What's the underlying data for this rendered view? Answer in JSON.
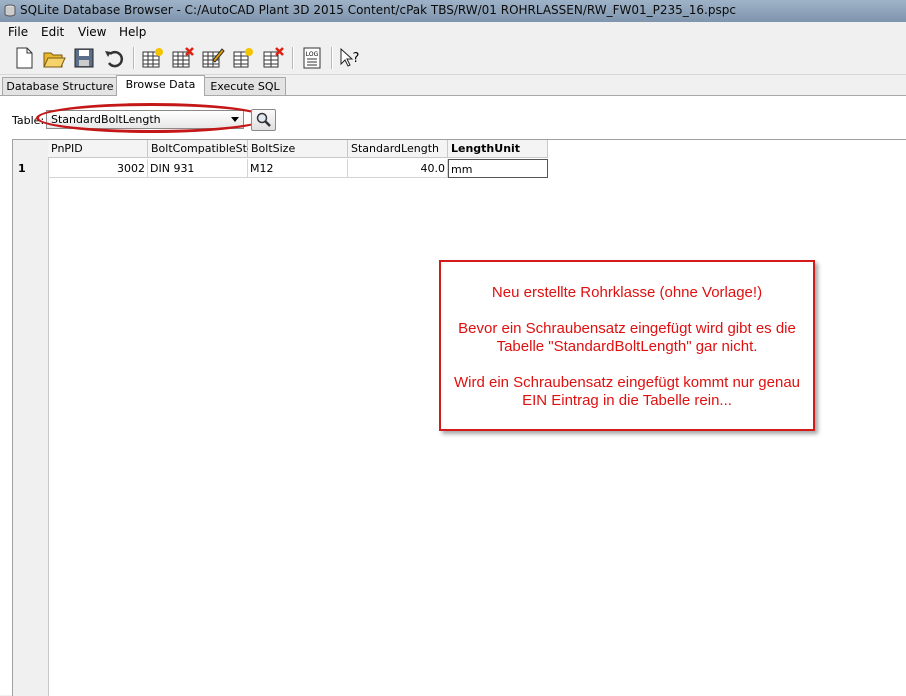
{
  "window": {
    "title": "SQLite Database Browser - C:/AutoCAD Plant 3D 2015 Content/cPak TBS/RW/01 ROHRLASSEN/RW_FW01_P235_16.pspc"
  },
  "menu": [
    "File",
    "Edit",
    "View",
    "Help"
  ],
  "toolbar": {
    "icons": [
      "new-database-icon",
      "open-database-icon",
      "save-icon",
      "undo-icon",
      "create-table-icon",
      "delete-table-icon",
      "modify-table-icon",
      "create-index-icon",
      "delete-index-icon",
      "log-icon",
      "whats-this-icon"
    ],
    "log_label": "LOG"
  },
  "tabs": [
    "Database Structure",
    "Browse Data",
    "Execute SQL"
  ],
  "active_tab": "Browse Data",
  "browse": {
    "table_label": "Table:",
    "table_selected": "StandardBoltLength",
    "columns": [
      "PnPID",
      "BoltCompatibleStd",
      "BoltSize",
      "StandardLength",
      "LengthUnit"
    ],
    "rows": [
      {
        "num": "1",
        "cells": [
          "3002",
          "DIN 931",
          "M12",
          "40.0",
          "mm"
        ]
      }
    ]
  },
  "annotation": {
    "line1": "Neu erstellte Rohrklasse (ohne Vorlage!)",
    "line2": "Bevor ein Schraubensatz eingefügt wird gibt es die",
    "line3": "Tabelle \"StandardBoltLength\" gar nicht.",
    "line4": "Wird ein Schraubensatz eingefügt kommt nur genau",
    "line5": "EIN Eintrag in die Tabelle rein...",
    "color": "#e01010",
    "highlight_color": "#c41818"
  }
}
